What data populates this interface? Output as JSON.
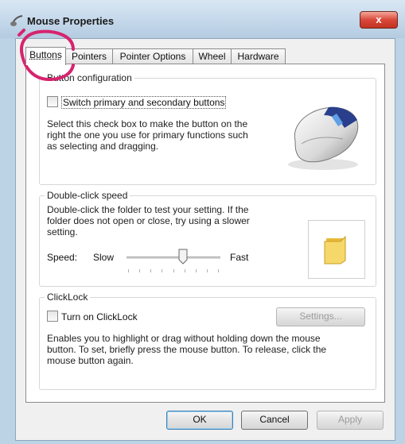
{
  "window": {
    "title": "Mouse Properties",
    "close_symbol": "x"
  },
  "tabs": [
    {
      "label": "Buttons",
      "active": true
    },
    {
      "label": "Pointers",
      "active": false
    },
    {
      "label": "Pointer Options",
      "active": false
    },
    {
      "label": "Wheel",
      "active": false
    },
    {
      "label": "Hardware",
      "active": false
    }
  ],
  "button_config": {
    "legend": "Button configuration",
    "checkbox_label": "Switch primary and secondary buttons",
    "checked": false,
    "description": [
      "Select this check box to make the button on the",
      "right the one you use for primary functions such",
      "as selecting and dragging."
    ]
  },
  "double_click": {
    "legend": "Double-click speed",
    "description": [
      "Double-click the folder to test your setting. If the",
      "folder does not open or close, try using a slower",
      "setting."
    ],
    "speed_label": "Speed:",
    "slow_label": "Slow",
    "fast_label": "Fast",
    "slider_value_percent": 60
  },
  "clicklock": {
    "legend": "ClickLock",
    "checkbox_label": "Turn on ClickLock",
    "checked": false,
    "settings_button": "Settings...",
    "description": [
      "Enables you to highlight or drag without holding down the mouse",
      "button. To set, briefly press the mouse button. To release, click the",
      "mouse button again."
    ]
  },
  "footer": {
    "ok": "OK",
    "cancel": "Cancel",
    "apply": "Apply"
  },
  "icons": {
    "title": "mouse-icon",
    "illustration": "mouse-illustration",
    "test": "folder-icon"
  },
  "colors": {
    "annotation": "#d6246e",
    "close": "#c9402f",
    "folder": "#f2c94c"
  }
}
